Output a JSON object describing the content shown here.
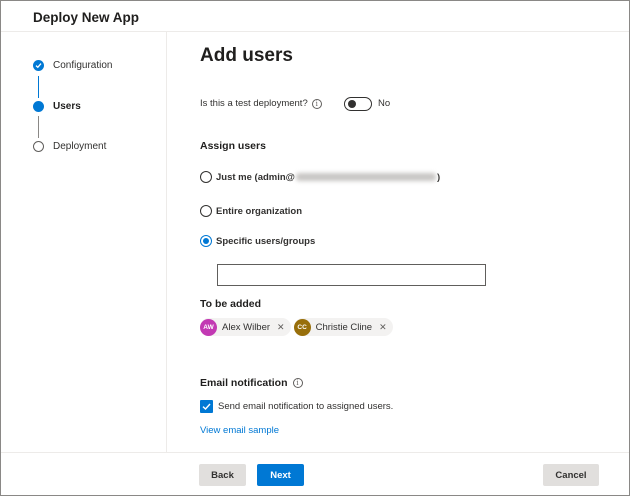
{
  "header": {
    "title": "Deploy New App"
  },
  "steps": [
    {
      "label": "Configuration",
      "state": "done"
    },
    {
      "label": "Users",
      "state": "current"
    },
    {
      "label": "Deployment",
      "state": "todo"
    }
  ],
  "main": {
    "title": "Add users",
    "test_deployment": {
      "question": "Is this a test deployment?",
      "toggle_label": "No",
      "toggle_on": false
    },
    "assign_users": {
      "heading": "Assign users",
      "options": [
        {
          "prefix": "Just me (admin@",
          "suffix": ")",
          "selected": false
        },
        {
          "label": "Entire organization",
          "selected": false
        },
        {
          "label": "Specific users/groups",
          "selected": true
        }
      ],
      "search_value": ""
    },
    "to_be_added": {
      "heading": "To be added",
      "people": [
        {
          "initials": "AW",
          "name": "Alex Wilber",
          "color": "#c239b3"
        },
        {
          "initials": "CC",
          "name": "Christie Cline",
          "color": "#986f0b"
        }
      ]
    },
    "email": {
      "heading": "Email notification",
      "checkbox_label": "Send email notification to assigned users.",
      "checked": true,
      "link": "View email sample"
    }
  },
  "footer": {
    "back": "Back",
    "next": "Next",
    "cancel": "Cancel"
  },
  "colors": {
    "accent": "#0078d4"
  }
}
